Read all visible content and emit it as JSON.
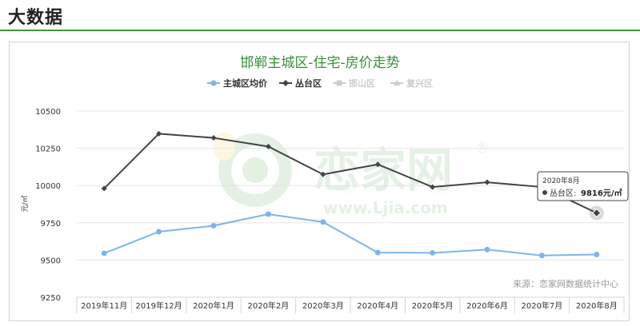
{
  "section": {
    "title": "大数据"
  },
  "chart_data": {
    "type": "line",
    "title": "邯郸主城区-住宅-房价走势",
    "ylabel": "元/㎡",
    "xlabel": "",
    "categories": [
      "2019年11月",
      "2019年12月",
      "2020年1月",
      "2020年2月",
      "2020年3月",
      "2020年4月",
      "2020年5月",
      "2020年6月",
      "2020年7月",
      "2020年8月"
    ],
    "ylim": [
      9250,
      10500
    ],
    "yticks": [
      9250,
      9500,
      9750,
      10000,
      10250,
      10500
    ],
    "series": [
      {
        "name": "主城区均价",
        "color": "#7cb5ec",
        "marker": "circle",
        "active": true,
        "values": [
          9545,
          9690,
          9730,
          9808,
          9755,
          9550,
          9548,
          9570,
          9530,
          9537
        ]
      },
      {
        "name": "丛台区",
        "color": "#434348",
        "marker": "diamond",
        "active": true,
        "values": [
          9980,
          10348,
          10320,
          10262,
          10075,
          10142,
          9990,
          10022,
          9990,
          9816
        ]
      },
      {
        "name": "邯山区",
        "color": "#cccccc",
        "marker": "square",
        "active": false,
        "values": []
      },
      {
        "name": "复兴区",
        "color": "#cccccc",
        "marker": "triangle",
        "active": false,
        "values": []
      }
    ],
    "grid": true,
    "legend_position": "top-center",
    "source_note": "来源：恋家网数据统计中心",
    "tooltip": {
      "title": "2020年8月",
      "label": "丛台区: ",
      "value": "9816元/㎡"
    }
  },
  "watermark": {
    "text_cn": "恋家网",
    "text_url": "www.Ljia.com",
    "mark": "®"
  }
}
